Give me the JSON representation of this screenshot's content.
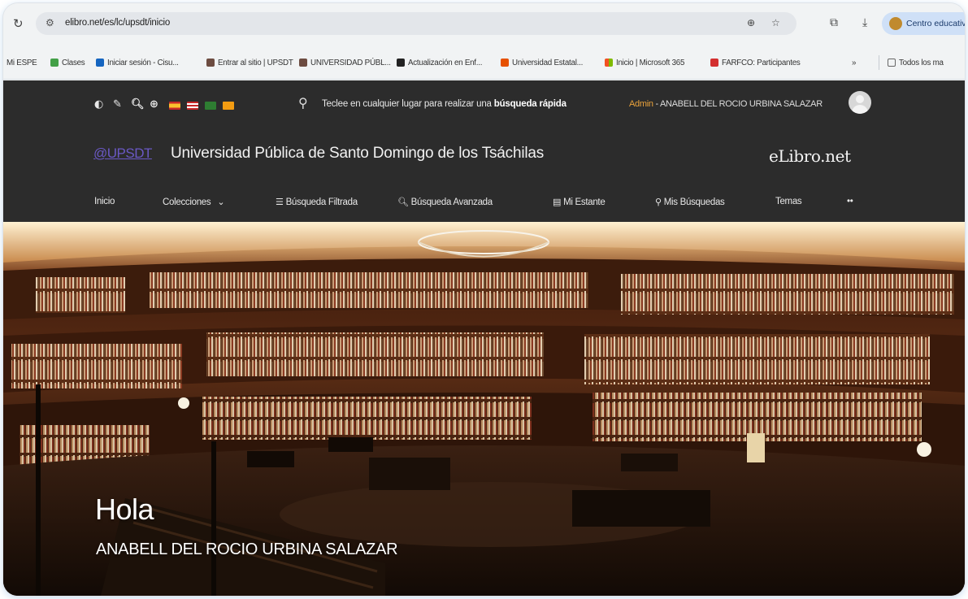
{
  "browser": {
    "url": "elibro.net/es/lc/upsdt/inicio",
    "profile_label": "Centro educativ",
    "bookmarks": [
      {
        "label": "Mi ESPE",
        "color": "#ffffff"
      },
      {
        "label": "Clases",
        "color": "#43a047"
      },
      {
        "label": "Iniciar sesión - Cisu...",
        "color": "#1565c0"
      },
      {
        "label": "Entrar al sitio | UPSDT",
        "color": "#6d4c41"
      },
      {
        "label": "UNIVERSIDAD PÚBL...",
        "color": "#6d4c41"
      },
      {
        "label": "Actualización en Enf...",
        "color": "#222222"
      },
      {
        "label": "Universidad Estatal...",
        "color": "#e65100"
      },
      {
        "label": "Inicio | Microsoft 365",
        "color": "#f25022"
      },
      {
        "label": "FARFCO: Participantes",
        "color": "#d32f2f"
      }
    ],
    "more_label": "»",
    "all_bookmarks_label": "Todos los ma"
  },
  "site": {
    "quick_search_text": "Teclee en cualquier lugar para realizar una ",
    "quick_search_bold": "búsqueda rápida",
    "admin_label": "Admin",
    "admin_sep": " - ",
    "admin_name": "ANABELL DEL ROCIO URBINA SALAZAR",
    "logo": "@UPSDT",
    "university": "Universidad Pública de Santo Domingo de los Tsáchilas",
    "brand": "eLibro.net",
    "menu": {
      "inicio": "Inicio",
      "colecciones": "Colecciones",
      "busqueda_filtrada": "Búsqueda Filtrada",
      "busqueda_avanzada": "Búsqueda Avanzada",
      "mi_estante": "Mi Estante",
      "mis_busquedas": "Mis Búsquedas",
      "temas": "Temas",
      "more": "••"
    }
  },
  "hero": {
    "greeting": "Hola",
    "name": "ANABELL DEL ROCIO URBINA SALAZAR"
  }
}
